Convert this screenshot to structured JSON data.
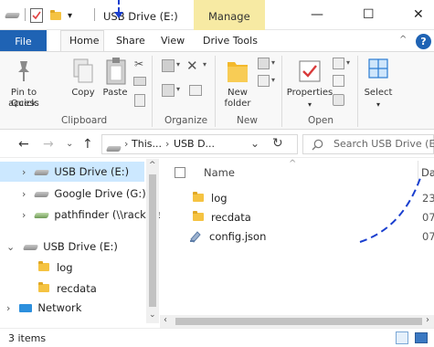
{
  "window": {
    "title": "USB Drive (E:)",
    "context_tab": "Manage"
  },
  "controls": {
    "minimize": "—",
    "maximize": "☐",
    "close": "✕"
  },
  "tabs": {
    "file": "File",
    "home": "Home",
    "share": "Share",
    "view": "View",
    "drive_tools": "Drive Tools"
  },
  "ribbon": {
    "pin_line1": "Pin to Quick",
    "pin_line2": "access",
    "copy": "Copy",
    "paste": "Paste",
    "new_line1": "New",
    "new_line2": "folder",
    "properties": "Properties",
    "select": "Select",
    "groups": {
      "clipboard": "Clipboard",
      "organize": "Organize",
      "new": "New",
      "open": "Open"
    }
  },
  "address": {
    "seg1": "This...",
    "seg2": "USB D...",
    "search_placeholder": "Search USB Drive (E:)"
  },
  "nav": {
    "items": [
      {
        "label": "USB Drive (E:)"
      },
      {
        "label": "Google Drive (G:)"
      },
      {
        "label": "pathfinder (\\\\racksta"
      },
      {
        "label": "USB Drive (E:)"
      },
      {
        "label": "log"
      },
      {
        "label": "recdata"
      },
      {
        "label": "Network"
      }
    ]
  },
  "content": {
    "name_header": "Name",
    "date_header_cut": "Da",
    "files": [
      {
        "name": "log",
        "date_cut": "23"
      },
      {
        "name": "recdata",
        "date_cut": "07"
      },
      {
        "name": "config.json",
        "date_cut": "07"
      }
    ]
  },
  "status": {
    "count": "3 items"
  },
  "colors": {
    "accent": "#1f63b4",
    "manage_tab": "#f7eaa3",
    "selection": "#cce8ff",
    "annotation": "#1a3fcf"
  }
}
